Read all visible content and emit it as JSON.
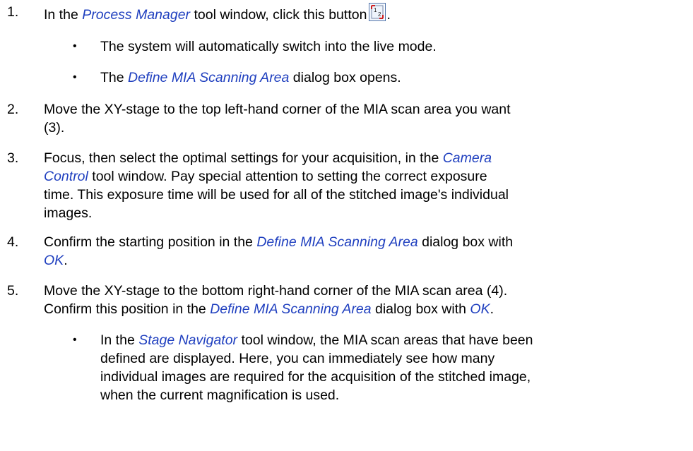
{
  "steps": [
    {
      "num": "1.",
      "before": "In the ",
      "em1": "Process Manager",
      "after": " tool window, click this button",
      "end": ".",
      "icon": "mia-define-area-icon",
      "bullets": [
        {
          "text": "The system will automatically switch into the live mode."
        },
        {
          "em": "Define MIA Scanning Area",
          "after": " dialog box opens.",
          "before": "The "
        }
      ]
    },
    {
      "num": "2.",
      "line1": "Move the XY-stage to the top left-hand corner of the MIA scan area you want",
      "line2": "(3)."
    },
    {
      "num": "3.",
      "before": "Focus, then select the optimal settings for your acquisition, in the ",
      "em1": "Camera",
      "em2": "Control",
      "after": " tool window. Pay special attention to setting the correct exposure",
      "line3": "time. This exposure time will be used for all of the stitched image's individual",
      "line4": "images."
    },
    {
      "num": "4.",
      "before": "Confirm the starting position in the ",
      "em1": "Define MIA Scanning Area",
      "after": " dialog box with",
      "em2": "OK",
      "end": "."
    },
    {
      "num": "5.",
      "line1": "Move the XY-stage to the bottom right-hand corner of the MIA scan area (4).",
      "before2": "Confirm this position in the ",
      "em1": "Define MIA Scanning Area",
      "after2": " dialog box with ",
      "em2": "OK",
      "end": ".",
      "bullets": [
        {
          "before": "In the ",
          "em": "Stage Navigator",
          "after": " tool window, the MIA scan areas that have been",
          "line2": "defined are displayed. Here, you can immediately see how many",
          "line3": "individual images are required for the acquisition of the stitched image,",
          "line4": "when the current magnification is used."
        }
      ]
    }
  ],
  "bullet_glyph": "•",
  "icon_label": "1 2",
  "colors": {
    "emphasis": "#1f3fbf",
    "text": "#000000"
  }
}
